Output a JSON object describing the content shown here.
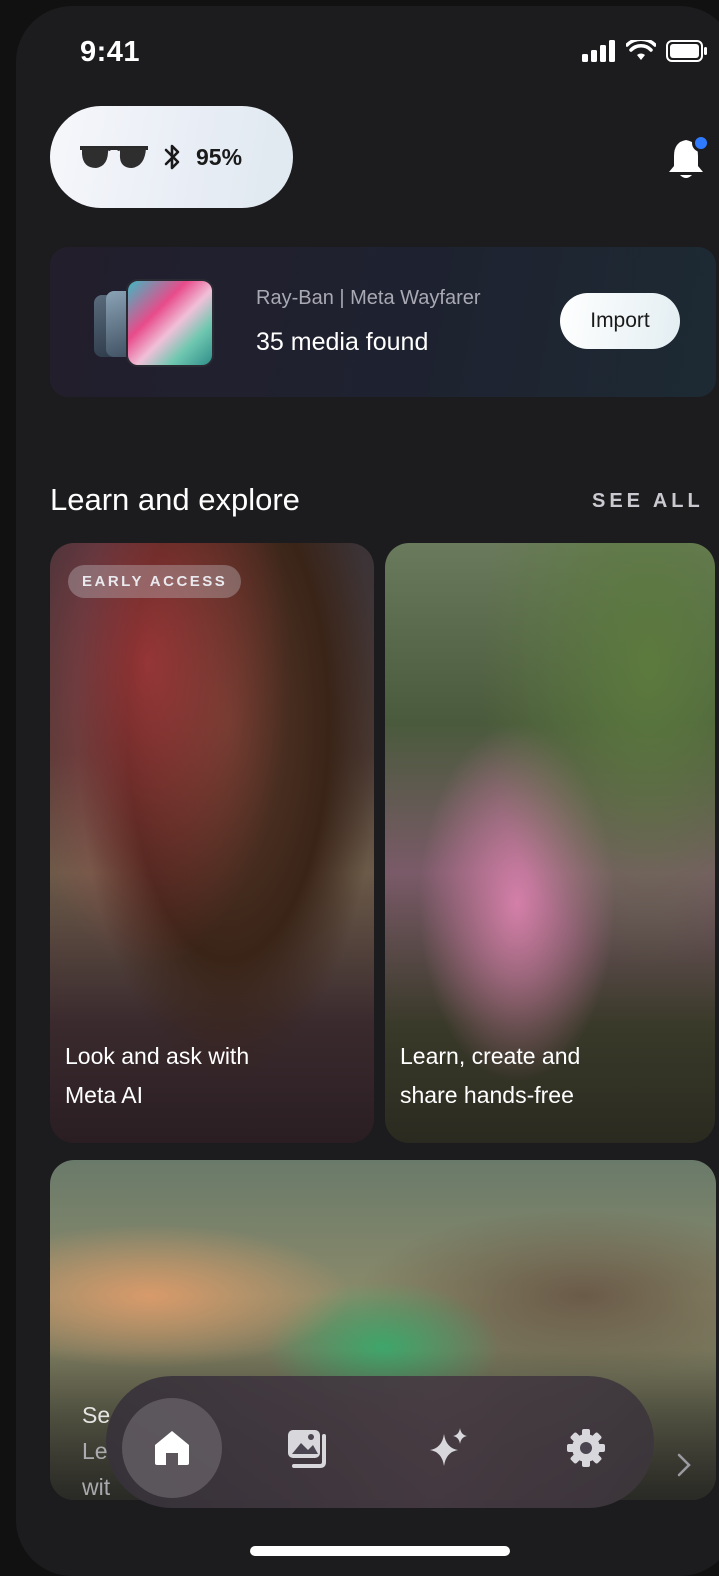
{
  "status_bar": {
    "time": "9:41"
  },
  "device": {
    "battery": "95%"
  },
  "import_card": {
    "device_name": "Ray-Ban | Meta Wayfarer",
    "media_found": "35 media found",
    "import_label": "Import"
  },
  "explore": {
    "title": "Learn and explore",
    "see_all": "SEE ALL",
    "cards": [
      {
        "badge": "EARLY ACCESS",
        "caption_line1": "Look and ask with",
        "caption_line2": "Meta AI"
      },
      {
        "caption_line1": "Learn, create and",
        "caption_line2": "share hands-free"
      },
      {
        "caption_line1": "Se",
        "caption_line2": "Le",
        "caption_line3": "wit"
      }
    ]
  },
  "nav": {
    "items": [
      {
        "icon": "home-icon",
        "active": true
      },
      {
        "icon": "gallery-icon",
        "active": false
      },
      {
        "icon": "sparkle-icon",
        "active": false
      },
      {
        "icon": "gear-icon",
        "active": false
      }
    ]
  },
  "colors": {
    "background": "#1c1c1e",
    "accent_dot": "#2f7bff"
  }
}
